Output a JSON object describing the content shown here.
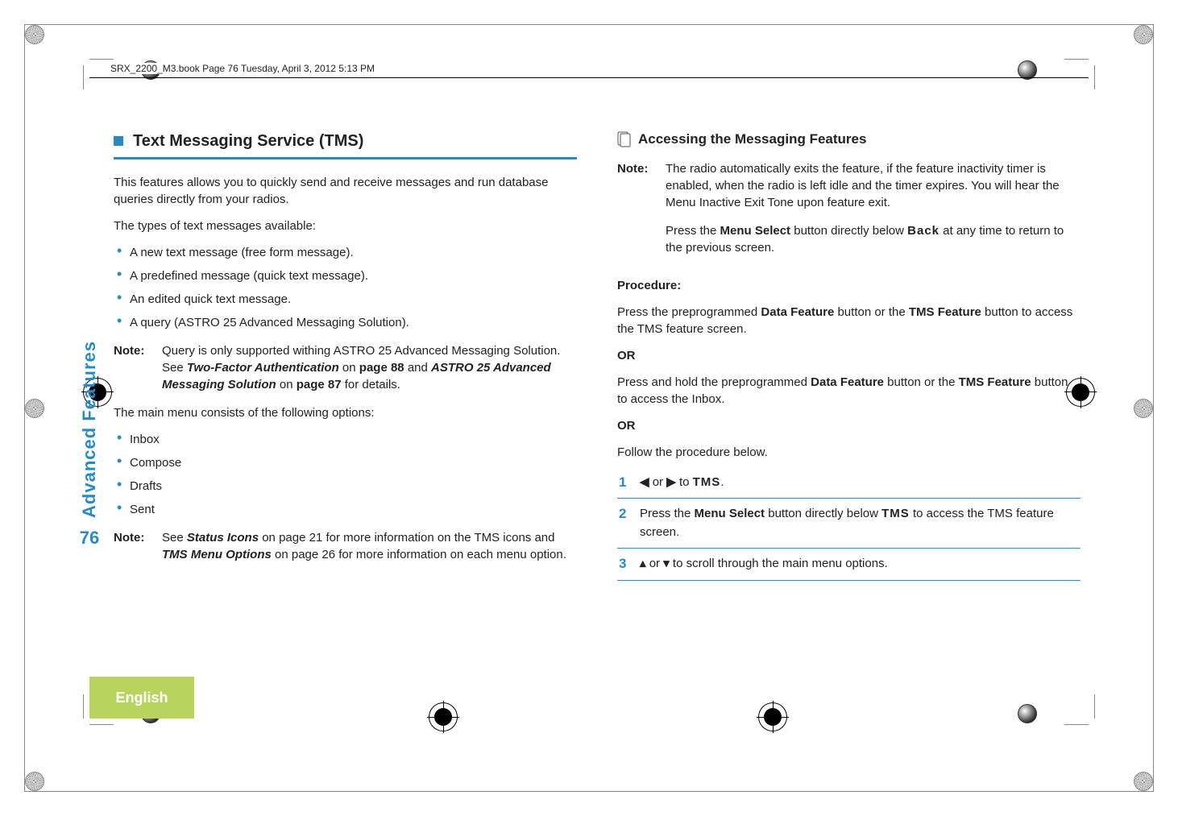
{
  "header": {
    "running_head": "SRX_2200_M3.book  Page 76  Tuesday, April 3, 2012  5:13 PM"
  },
  "side": {
    "section_label": "Advanced Features",
    "page_number": "76",
    "language": "English"
  },
  "left": {
    "title": "Text Messaging Service (TMS)",
    "intro1": "This features allows you to quickly send and receive messages and run database queries directly from your radios.",
    "intro2": "The types of text messages available:",
    "types": [
      "A new text message (free form message).",
      "A predefined message (quick text message).",
      "An edited quick text message.",
      "A query (ASTRO 25 Advanced Messaging Solution)."
    ],
    "note1_label": "Note:",
    "note1_body_a": "Query is only supported withing ASTRO 25 Advanced Messaging Solution. See ",
    "note1_ref1": "Two-Factor Authentication",
    "note1_body_b": " on ",
    "note1_page1": "page 88",
    "note1_body_c": " and ",
    "note1_ref2": "ASTRO 25 Advanced Messaging Solution",
    "note1_body_d": " on ",
    "note1_page2": "page 87",
    "note1_body_e": " for details.",
    "intro3": "The main menu consists of the following options:",
    "menu_items": [
      "Inbox",
      "Compose",
      "Drafts",
      "Sent"
    ],
    "note2_label": "Note:",
    "note2_body_a": "See ",
    "note2_ref1": "Status Icons",
    "note2_body_b": " on page 21 for more information on the TMS icons and ",
    "note2_ref2": "TMS Menu Options",
    "note2_body_c": " on page 26 for more information on each menu option."
  },
  "right": {
    "title": "Accessing the Messaging Features",
    "note_label": "Note:",
    "note_body1": "The radio automatically exits the feature, if the feature inactivity timer is enabled, when the radio is left idle and the timer expires. You will hear the Menu Inactive Exit Tone upon feature exit.",
    "note_body2_a": "Press the ",
    "note_body2_b": "Menu Select",
    "note_body2_c": " button directly below ",
    "note_body2_ui": "Back",
    "note_body2_d": " at any time to return to the previous screen.",
    "proc_label": "Procedure:",
    "proc_line1_a": "Press the preprogrammed ",
    "proc_line1_b": "Data Feature",
    "proc_line1_c": " button or the ",
    "proc_line1_d": "TMS Feature",
    "proc_line1_e": " button to access the TMS feature screen.",
    "or": "OR",
    "proc_line2_a": "Press and hold the preprogrammed ",
    "proc_line2_b": "Data Feature",
    "proc_line2_c": " button or the ",
    "proc_line2_d": "TMS Feature",
    "proc_line2_e": " button to access the Inbox.",
    "proc_line3": "Follow the procedure below.",
    "step1_a": " or ",
    "step1_b": " to ",
    "step1_ui": "TMS",
    "step1_c": ".",
    "step2_a": "Press the ",
    "step2_b": "Menu Select",
    "step2_c": " button directly below ",
    "step2_ui": "TMS",
    "step2_d": " to access the TMS feature screen.",
    "step3_a": " or ",
    "step3_b": " to scroll through the main menu options."
  }
}
